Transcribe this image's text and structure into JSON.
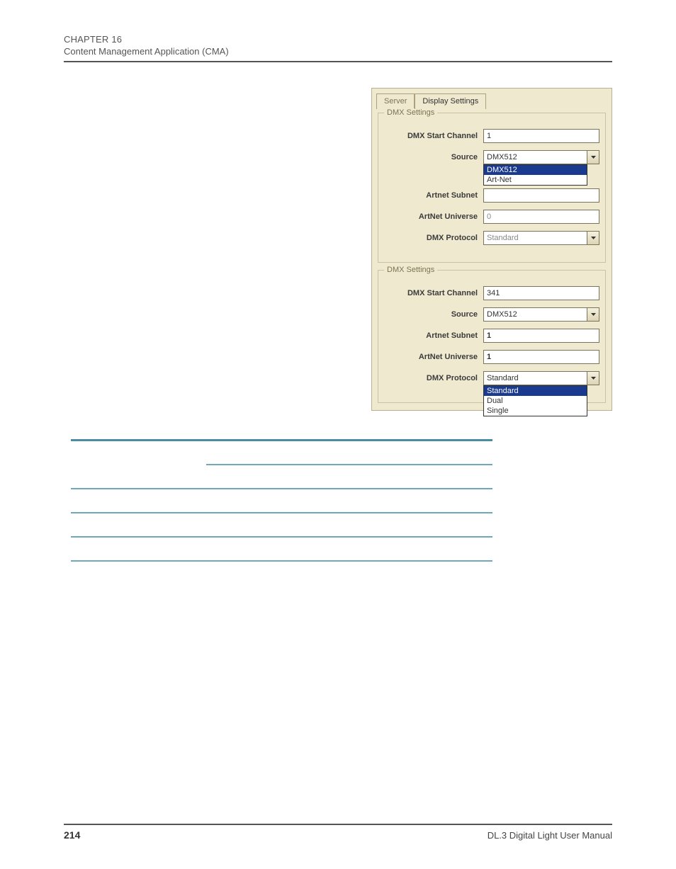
{
  "header": {
    "chapter": "CHAPTER 16",
    "subtitle": "Content Management Application (CMA)"
  },
  "screenshot": {
    "tabs": [
      {
        "label": "Server",
        "active": false
      },
      {
        "label": "Display Settings",
        "active": true
      }
    ],
    "group1": {
      "legend": "DMX Settings",
      "rows": {
        "dmx_start_channel": {
          "label": "DMX Start Channel",
          "value": "1"
        },
        "source": {
          "label": "Source",
          "selected": "DMX512",
          "options": [
            {
              "text": "DMX512",
              "hl": true
            },
            {
              "text": "Art-Net",
              "hl": false
            }
          ]
        },
        "artnet_subnet": {
          "label": "Artnet Subnet",
          "placeholder": ""
        },
        "artnet_universe": {
          "label": "ArtNet Universe",
          "value": "0"
        },
        "dmx_protocol": {
          "label": "DMX Protocol",
          "selected": "Standard"
        }
      }
    },
    "group2": {
      "legend": "DMX Settings",
      "rows": {
        "dmx_start_channel": {
          "label": "DMX Start Channel",
          "value": "341"
        },
        "source": {
          "label": "Source",
          "selected": "DMX512"
        },
        "artnet_subnet": {
          "label": "Artnet Subnet",
          "value": "1"
        },
        "artnet_universe": {
          "label": "ArtNet Universe",
          "value": "1"
        },
        "dmx_protocol": {
          "label": "DMX Protocol",
          "selected": "Standard",
          "options": [
            {
              "text": "Standard",
              "hl": true
            },
            {
              "text": "Dual",
              "hl": false
            },
            {
              "text": "Single",
              "hl": false
            }
          ]
        }
      }
    }
  },
  "footer": {
    "page": "214",
    "right": "DL.3 Digital Light User Manual"
  }
}
